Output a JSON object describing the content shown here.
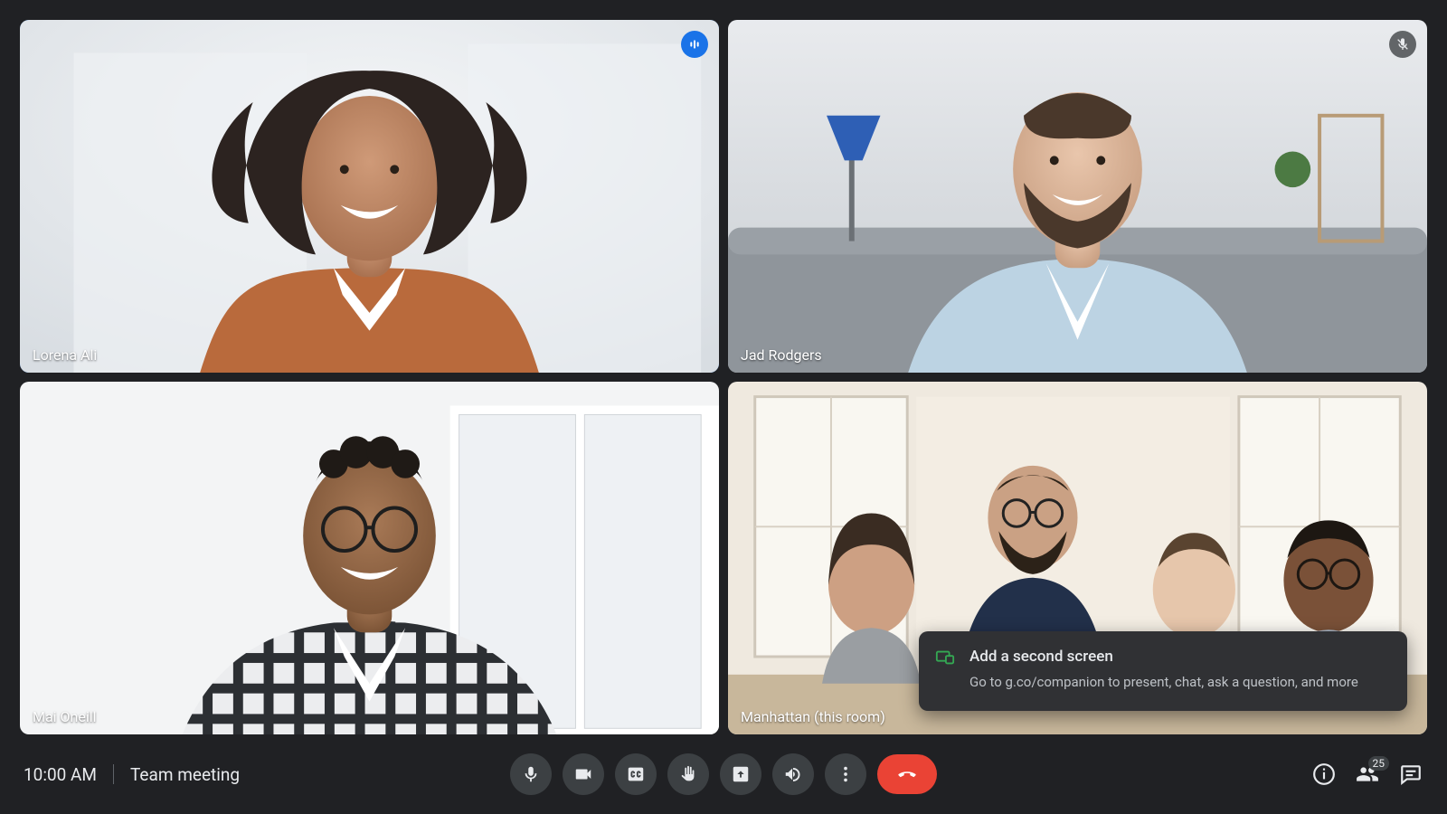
{
  "meeting": {
    "time": "10:00 AM",
    "title": "Team meeting",
    "participant_count": "25"
  },
  "tiles": [
    {
      "name": "Lorena Ali",
      "speaking": true,
      "muted": false
    },
    {
      "name": "Jad Rodgers",
      "speaking": false,
      "muted": true
    },
    {
      "name": "Mai Oneill",
      "speaking": false,
      "muted": false
    },
    {
      "name": "Manhattan (this room)",
      "speaking": false,
      "muted": false
    }
  ],
  "toast": {
    "title": "Add a second screen",
    "body": "Go to g.co/companion to present, chat, ask a question, and more"
  }
}
